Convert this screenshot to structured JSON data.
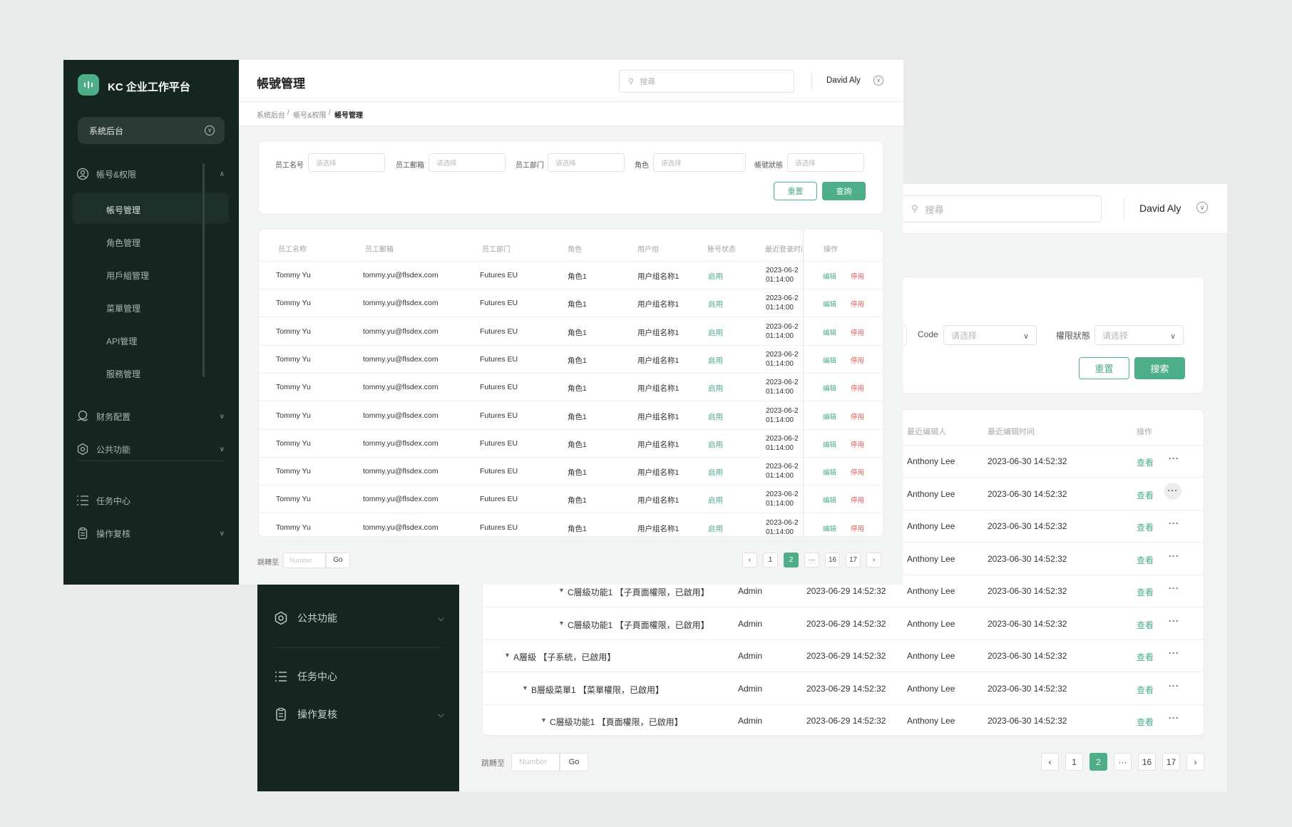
{
  "back_window": {
    "header": {
      "search_placeholder": "搜尋",
      "user_name": "David Aly"
    },
    "sidebar": {
      "items": [
        {
          "label": "公共功能",
          "icon": "hexagon-gear-icon",
          "has_chevron": true
        },
        {
          "label": "任务中心",
          "icon": "list-icon",
          "has_chevron": false
        },
        {
          "label": "操作复核",
          "icon": "clipboard-icon",
          "has_chevron": true
        }
      ]
    },
    "filters": {
      "code_label": "Code",
      "code_placeholder": "请选择",
      "status_label": "權限狀態",
      "status_placeholder": "请选择",
      "reset_label": "重置",
      "search_label": "搜索"
    },
    "table": {
      "headers": {
        "last_editor": "最近编辑人",
        "last_edit_time": "最近编辑时间",
        "actions": "操作"
      },
      "top_rows": [
        {
          "editor": "Anthony Lee",
          "time": "2023-06-30 14:52:32",
          "view": "查看"
        },
        {
          "editor": "Anthony Lee",
          "time": "2023-06-30 14:52:32",
          "view": "查看"
        },
        {
          "editor": "Anthony Lee",
          "time": "2023-06-30 14:52:32",
          "view": "查看"
        },
        {
          "editor": "Anthony Lee",
          "time": "2023-06-30 14:52:32",
          "view": "查看"
        }
      ],
      "tree_rows": [
        {
          "name": "C層級功能1 【子頁面權限，已啟用】",
          "creator": "Admin",
          "created": "2023-06-29 14:52:32",
          "editor": "Anthony Lee",
          "edited": "2023-06-30 14:52:32",
          "view": "查看"
        },
        {
          "name": "C層級功能1 【子頁面權限，已啟用】",
          "creator": "Admin",
          "created": "2023-06-29 14:52:32",
          "editor": "Anthony Lee",
          "edited": "2023-06-30 14:52:32",
          "view": "查看"
        },
        {
          "name": "A層級 【子系統，已啟用】",
          "creator": "Admin",
          "created": "2023-06-29 14:52:32",
          "editor": "Anthony Lee",
          "edited": "2023-06-30 14:52:32",
          "view": "查看"
        },
        {
          "name": "B層級菜單1 【菜單權限，已啟用】",
          "creator": "Admin",
          "created": "2023-06-29 14:52:32",
          "editor": "Anthony Lee",
          "edited": "2023-06-30 14:52:32",
          "view": "查看"
        },
        {
          "name": "C層級功能1 【頁面權限，已啟用】",
          "creator": "Admin",
          "created": "2023-06-29 14:52:32",
          "editor": "Anthony Lee",
          "edited": "2023-06-30 14:52:32",
          "view": "查看"
        }
      ]
    },
    "pager": {
      "jump_label": "跳轉至",
      "jump_placeholder": "Number",
      "go_label": "Go",
      "pages": [
        "1",
        "2",
        "···",
        "16",
        "17"
      ],
      "current": "2"
    }
  },
  "front_window": {
    "brand": "KC 企业工作平台",
    "system_select": "系統后台",
    "page_title": "帳號管理",
    "search_placeholder": "搜尋",
    "user_name": "David Aly",
    "breadcrumb": {
      "level1": "系統后台",
      "level2": "帳号&权限",
      "current": "帳号管理",
      "separator": "/"
    },
    "sidebar": {
      "group1": "帳号&权限",
      "sub_items": [
        "帳号管理",
        "角色管理",
        "用戶組管理",
        "菜單管理",
        "API管理",
        "服務管理"
      ],
      "group2": "财务配置",
      "group3": "公共功能",
      "task_center": "任务中心",
      "review": "操作复核"
    },
    "filters": {
      "name_label": "员工名号",
      "email_label": "员工郵箱",
      "dept_label": "员工部门",
      "role_label": "角色",
      "status_label": "帳號狀態",
      "placeholder": "请选择",
      "reset_label": "重置",
      "query_label": "查詢"
    },
    "table": {
      "headers": [
        "员工名称",
        "员工郵箱",
        "员工部门",
        "角色",
        "用户组",
        "账号状态",
        "最近登录时间",
        "操作"
      ],
      "rows": [
        {
          "name": "Tommy Yu",
          "email": "tommy.yu@flsdex.com",
          "dept": "Futures EU",
          "role": "角色1",
          "group": "用户组名称1",
          "status": "启用",
          "date": "2023-06-2",
          "time": "01:14:00",
          "edit": "编辑",
          "disable": "停用"
        },
        {
          "name": "Tommy Yu",
          "email": "tommy.yu@flsdex.com",
          "dept": "Futures EU",
          "role": "角色1",
          "group": "用户组名称1",
          "status": "启用",
          "date": "2023-06-2",
          "time": "01:14:00",
          "edit": "编辑",
          "disable": "停用"
        },
        {
          "name": "Tommy Yu",
          "email": "tommy.yu@flsdex.com",
          "dept": "Futures EU",
          "role": "角色1",
          "group": "用户组名称1",
          "status": "启用",
          "date": "2023-06-2",
          "time": "01:14:00",
          "edit": "编辑",
          "disable": "停用"
        },
        {
          "name": "Tommy Yu",
          "email": "tommy.yu@flsdex.com",
          "dept": "Futures EU",
          "role": "角色1",
          "group": "用户组名称1",
          "status": "启用",
          "date": "2023-06-2",
          "time": "01:14:00",
          "edit": "编辑",
          "disable": "停用"
        },
        {
          "name": "Tommy Yu",
          "email": "tommy.yu@flsdex.com",
          "dept": "Futures EU",
          "role": "角色1",
          "group": "用户组名称1",
          "status": "启用",
          "date": "2023-06-2",
          "time": "01:14:00",
          "edit": "编辑",
          "disable": "停用"
        },
        {
          "name": "Tommy Yu",
          "email": "tommy.yu@flsdex.com",
          "dept": "Futures EU",
          "role": "角色1",
          "group": "用户组名称1",
          "status": "启用",
          "date": "2023-06-2",
          "time": "01:14:00",
          "edit": "编辑",
          "disable": "停用"
        },
        {
          "name": "Tommy Yu",
          "email": "tommy.yu@flsdex.com",
          "dept": "Futures EU",
          "role": "角色1",
          "group": "用户组名称1",
          "status": "启用",
          "date": "2023-06-2",
          "time": "01:14:00",
          "edit": "编辑",
          "disable": "停用"
        },
        {
          "name": "Tommy Yu",
          "email": "tommy.yu@flsdex.com",
          "dept": "Futures EU",
          "role": "角色1",
          "group": "用户组名称1",
          "status": "启用",
          "date": "2023-06-2",
          "time": "01:14:00",
          "edit": "编辑",
          "disable": "停用"
        },
        {
          "name": "Tommy Yu",
          "email": "tommy.yu@flsdex.com",
          "dept": "Futures EU",
          "role": "角色1",
          "group": "用户组名称1",
          "status": "启用",
          "date": "2023-06-2",
          "time": "01:14:00",
          "edit": "编辑",
          "disable": "停用"
        },
        {
          "name": "Tommy Yu",
          "email": "tommy.yu@flsdex.com",
          "dept": "Futures EU",
          "role": "角色1",
          "group": "用户组名称1",
          "status": "启用",
          "date": "2023-06-2",
          "time": "01:14:00",
          "edit": "编辑",
          "disable": "停用"
        }
      ]
    },
    "pager": {
      "jump_label": "跳轉至",
      "jump_placeholder": "Number",
      "go_label": "Go",
      "pages": [
        "1",
        "2",
        "···",
        "16",
        "17"
      ],
      "current": "2"
    }
  },
  "colors": {
    "sidebar_bg": "#152520",
    "accent": "#4dae87",
    "danger": "#e05b5b",
    "page_bg": "#e9eaea"
  }
}
